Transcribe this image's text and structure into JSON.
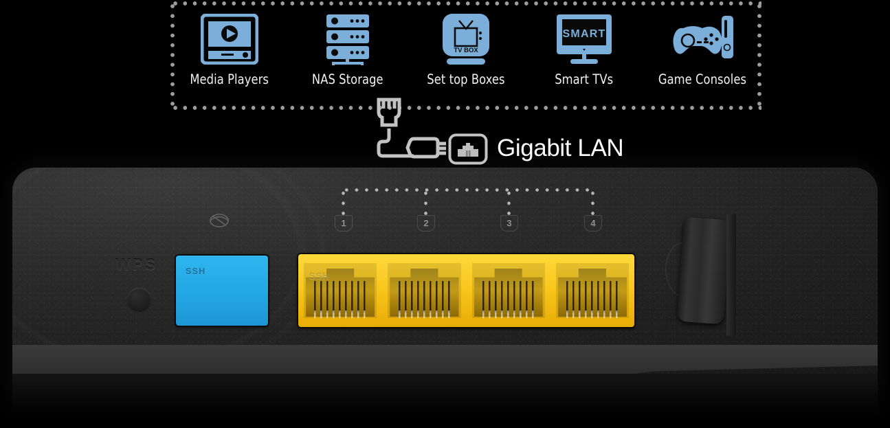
{
  "device_box": {
    "items": [
      {
        "icon": "media-player-icon",
        "label": "Media Players"
      },
      {
        "icon": "nas-storage-icon",
        "label": "NAS Storage"
      },
      {
        "icon": "set-top-box-icon",
        "label": "Set top Boxes",
        "icon_text": "TV BOX"
      },
      {
        "icon": "smart-tv-icon",
        "label": "Smart TVs",
        "icon_text": "SMART"
      },
      {
        "icon": "game-console-icon",
        "label": "Game Consoles"
      }
    ]
  },
  "connection": {
    "cable_icon": "ethernet-cable-icon",
    "jack_icon": "rj45-jack-icon",
    "label": "Gigabit LAN"
  },
  "router": {
    "wps_label": "WPS",
    "wps_button": "wps-button",
    "internet_mark": "globe-icon",
    "wan_port": {
      "name": "wan-port",
      "color": "#23a7e4",
      "mold_text": "SSH"
    },
    "lan_ports": [
      {
        "number": "1",
        "mold_text": "SSH"
      },
      {
        "number": "2",
        "mold_text": ""
      },
      {
        "number": "3",
        "mold_text": ""
      },
      {
        "number": "4",
        "mold_text": ""
      }
    ],
    "lan_color": "#f8c61d",
    "antenna": "antenna-hinge"
  },
  "colors": {
    "accent_blue": "#7BAFD9",
    "wan_blue": "#23a7e4",
    "lan_yellow": "#f8c61d",
    "dot_gray": "#9d9d9d",
    "background": "#000000"
  }
}
